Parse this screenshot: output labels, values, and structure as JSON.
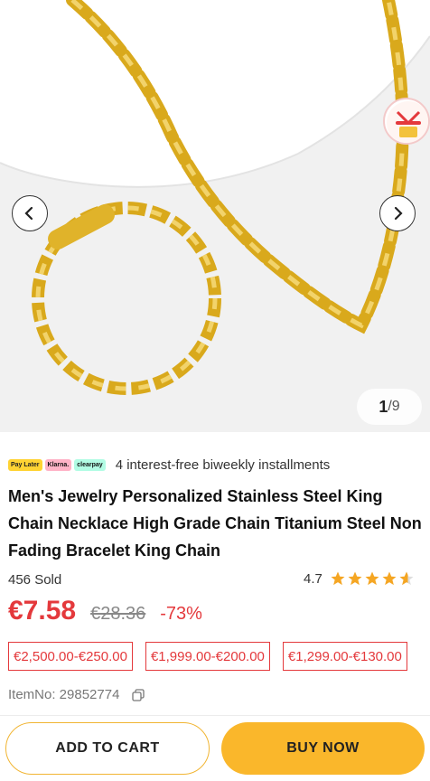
{
  "gallery": {
    "page_current": "1",
    "page_total": "/9",
    "prev_icon": "chevron-left-icon",
    "next_icon": "chevron-right-icon"
  },
  "payment": {
    "logos": [
      "Pay Later",
      "Klarna.",
      "clearpay"
    ],
    "text": "4 interest-free biweekly installments"
  },
  "product": {
    "title": "Men's Jewelry Personalized Stainless Steel King Chain Necklace High Grade Chain Titanium Steel Non Fading Bracelet King Chain",
    "sold": "456 Sold",
    "rating": "4.7",
    "rating_value": 4.7,
    "price": "€7.58",
    "original_price": "€28.36",
    "discount": "-73%",
    "coupons": [
      "€2,500.00-€250.00",
      "€1,999.00-€200.00",
      "€1,299.00-€130.00"
    ],
    "item_no": "ItemNo: 29852774"
  },
  "actions": {
    "add_to_cart": "ADD TO CART",
    "buy_now": "BUY NOW"
  },
  "colors": {
    "price_red": "#e4393c",
    "buy_yellow": "#fab72b",
    "star": "#f5a623"
  }
}
